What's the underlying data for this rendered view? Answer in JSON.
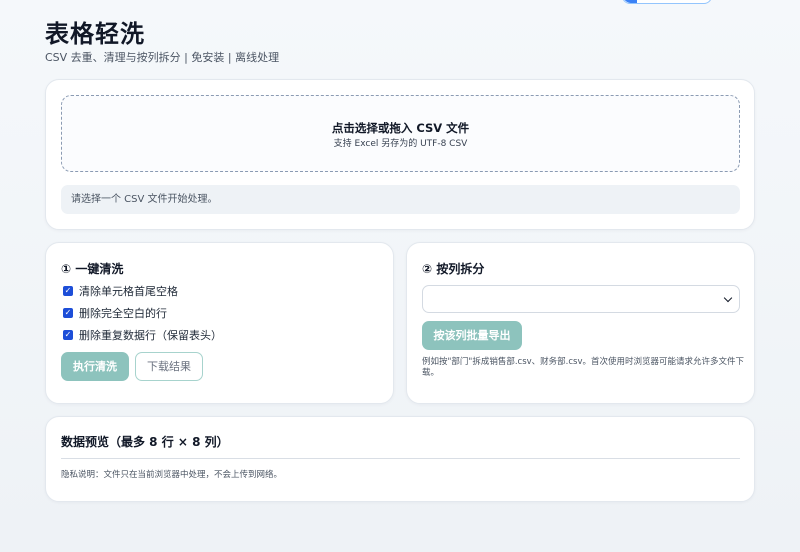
{
  "app": {
    "title": "表格轻洗",
    "subtitle": "CSV 去重、清理与按列拆分 | 免安装 | 离线处理"
  },
  "upload": {
    "title": "点击选择或拖入 CSV 文件",
    "hint": "支持 Excel 另存为的 UTF-8 CSV",
    "status": "请选择一个 CSV 文件开始处理。"
  },
  "clean": {
    "heading": "① 一键清洗",
    "options": [
      {
        "label": "清除单元格首尾空格",
        "checked": true
      },
      {
        "label": "删除完全空白的行",
        "checked": true
      },
      {
        "label": "删除重复数据行（保留表头）",
        "checked": true
      }
    ],
    "run_label": "执行清洗",
    "download_label": "下载结果"
  },
  "split": {
    "heading": "② 按列拆分",
    "select_value": "",
    "export_label": "按该列批量导出",
    "hint": "例如按\"部门\"拆成销售部.csv、财务部.csv。首次使用时浏览器可能请求允许多文件下载。"
  },
  "preview": {
    "heading": "数据预览（最多 8 行 × 8 列）",
    "privacy": "隐私说明：文件只在当前浏览器中处理，不会上传到网络。"
  },
  "colors": {
    "accent": "#8dc3bd",
    "checkbox": "#1d4ed8",
    "background": "#f1f5f9"
  },
  "icons": {
    "checkbox_mark": "check-icon",
    "select_arrow": "chevron-down-icon"
  }
}
